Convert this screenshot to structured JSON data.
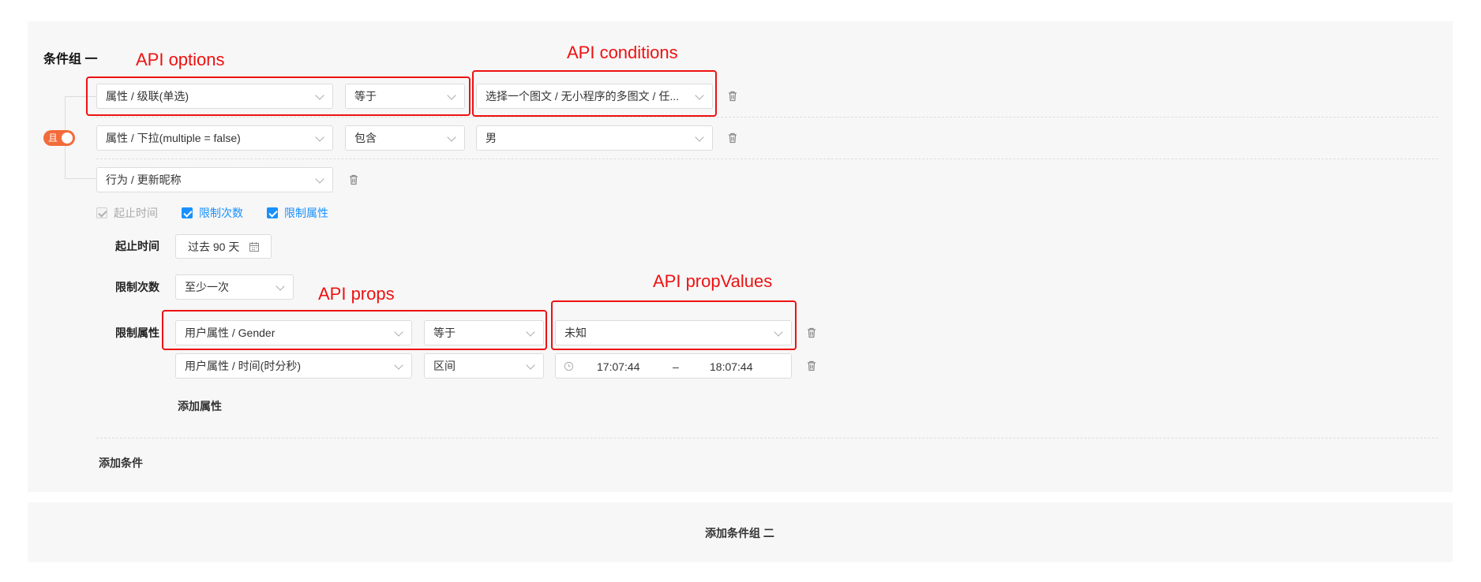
{
  "group1": {
    "title": "条件组 一",
    "logic_toggle_label": "且",
    "conditions": [
      {
        "field": "属性 / 级联(单选)",
        "operator": "等于",
        "value": "选择一个图文 / 无小程序的多图文 / 任..."
      },
      {
        "field": "属性 / 下拉(multiple = false)",
        "operator": "包含",
        "value": "男"
      },
      {
        "field": "行为 / 更新昵称"
      }
    ],
    "checkboxes": [
      {
        "label": "起止时间",
        "checked": true,
        "disabled": true
      },
      {
        "label": "限制次数",
        "checked": true,
        "disabled": false
      },
      {
        "label": "限制属性",
        "checked": true,
        "disabled": false
      }
    ],
    "time_range": {
      "label": "起止时间",
      "value": "过去 90 天"
    },
    "limit_count": {
      "label": "限制次数",
      "value": "至少一次"
    },
    "limit_props": {
      "label": "限制属性",
      "rows": [
        {
          "field": "用户属性 / Gender",
          "operator": "等于",
          "value": "未知"
        },
        {
          "field": "用户属性 / 时间(时分秒)",
          "operator": "区间",
          "start": "17:07:44",
          "separator": "–",
          "end": "18:07:44"
        }
      ],
      "add_label": "添加属性"
    },
    "add_condition_label": "添加条件"
  },
  "add_group_label": "添加条件组 二",
  "annotations": {
    "options": "API options",
    "conditions": "API conditions",
    "props": "API props",
    "propValues": "API propValues"
  },
  "colors": {
    "accent": "#1890ff",
    "toggle": "#f26b3a",
    "annotation": "#e11111",
    "panel": "#f7f7f7"
  }
}
